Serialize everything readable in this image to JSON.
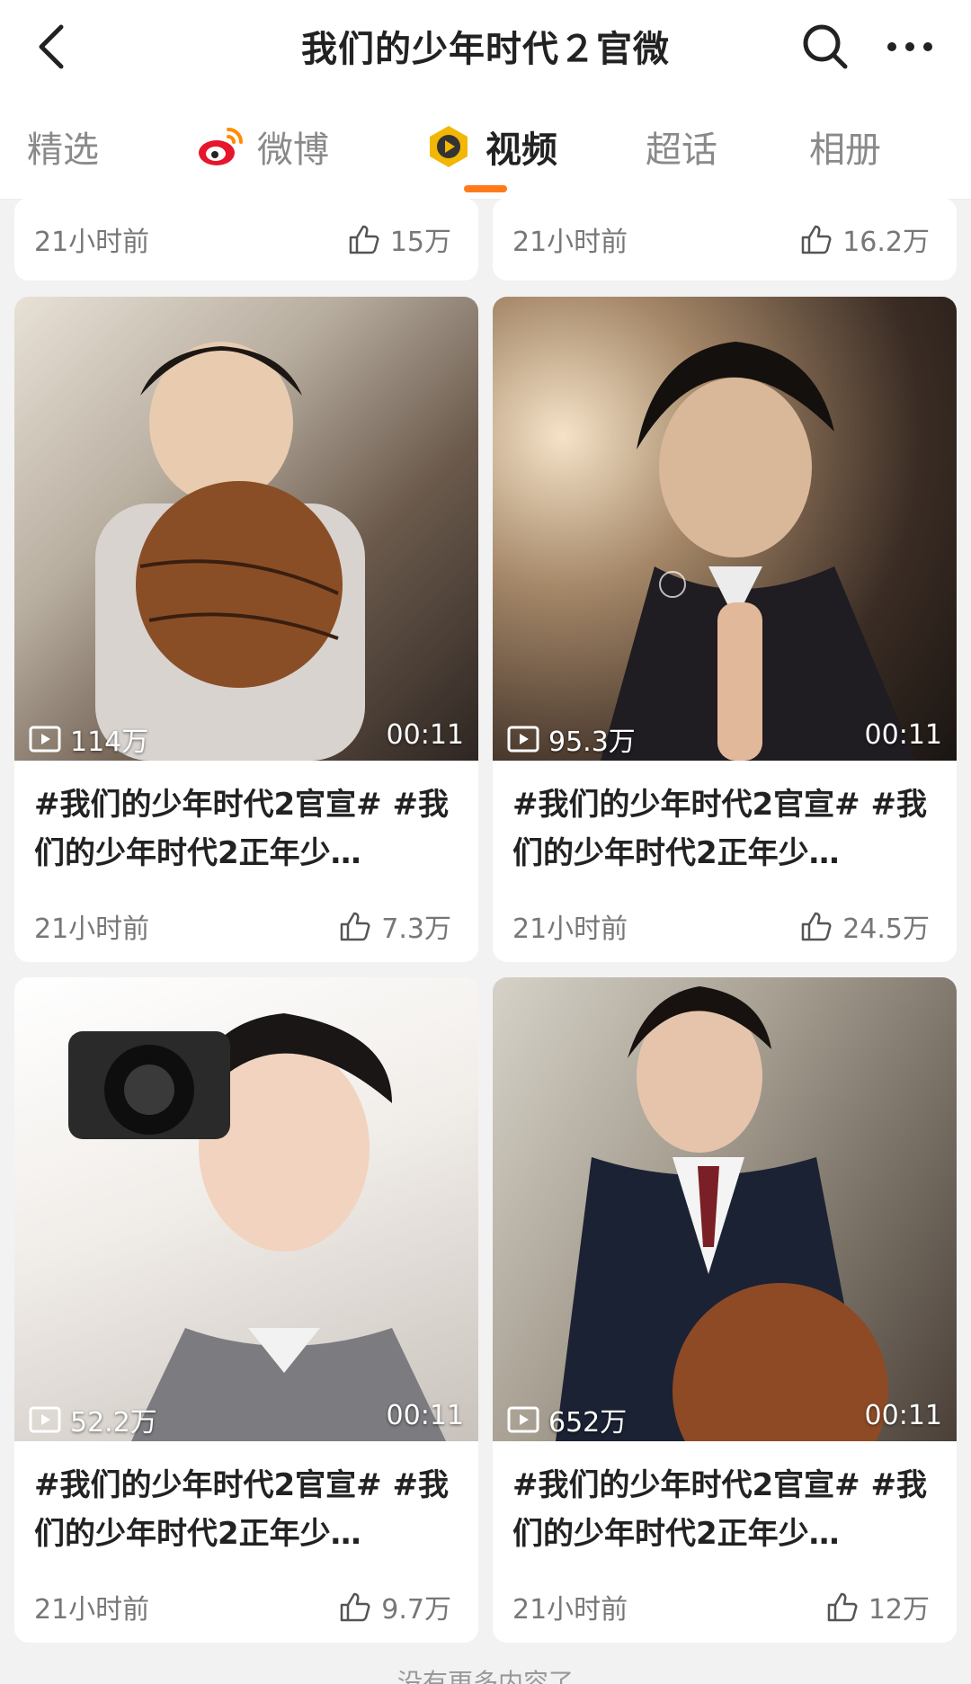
{
  "header": {
    "title": "我们的少年时代２官微",
    "back_icon": "chevron-left-icon",
    "search_icon": "search-icon",
    "more_icon": "more-dots-icon"
  },
  "tabs": [
    {
      "label": "精选",
      "icon": ""
    },
    {
      "label": "微博",
      "icon": "weibo-logo-icon"
    },
    {
      "label": "视频",
      "icon": "video-channel-icon",
      "active": true
    },
    {
      "label": "超话",
      "icon": ""
    },
    {
      "label": "相册",
      "icon": ""
    }
  ],
  "accent_color": "#ff7a1a",
  "top_row": [
    {
      "time": "21小时前",
      "likes": "15万"
    },
    {
      "time": "21小时前",
      "likes": "16.2万"
    }
  ],
  "videos": [
    {
      "views": "114万",
      "duration": "00:11",
      "title": "#我们的少年时代2官宣# #我们的少年时代2正年少…",
      "time": "21小时前",
      "likes": "7.3万"
    },
    {
      "views": "95.3万",
      "duration": "00:11",
      "title": "#我们的少年时代2官宣# #我们的少年时代2正年少…",
      "time": "21小时前",
      "likes": "24.5万"
    },
    {
      "views": "52.2万",
      "duration": "00:11",
      "title": "#我们的少年时代2官宣# #我们的少年时代2正年少…",
      "time": "21小时前",
      "likes": "9.7万"
    },
    {
      "views": "652万",
      "duration": "00:11",
      "title": "#我们的少年时代2官宣# #我们的少年时代2正年少…",
      "time": "21小时前",
      "likes": "12万"
    }
  ],
  "footer_text": "没有更多内容了"
}
